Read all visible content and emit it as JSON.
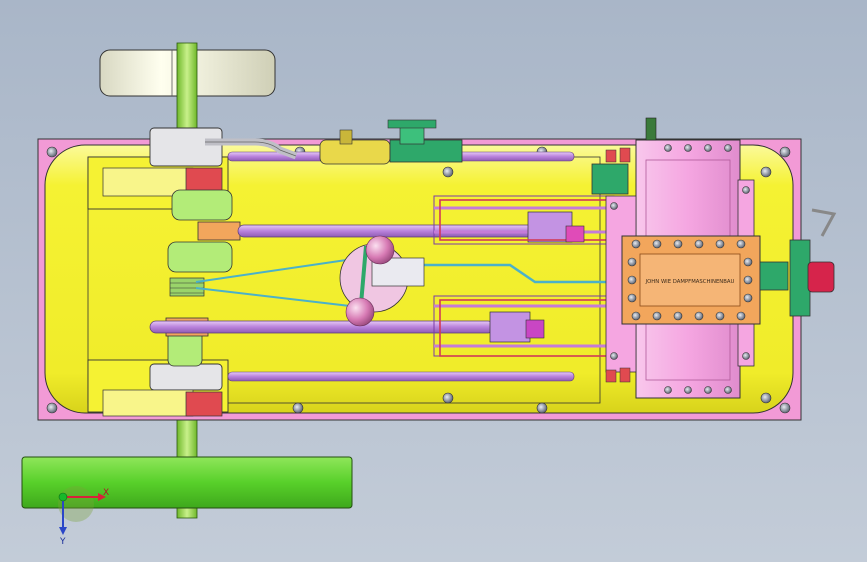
{
  "viewport": {
    "background_top": "#a9b6c8",
    "background_bottom": "#c3ccd8"
  },
  "axis_triad": {
    "x_label": "X",
    "y_label": "Y"
  },
  "nameplate": {
    "text": "JOHN WIE DAMPFMASCHINENBAU"
  },
  "colors": {
    "base_plate": "#f29ad6",
    "boiler": "#f5f233",
    "flywheel_top": "#f1f1df",
    "flywheel_bottom": "#58d02a",
    "shaft": "#98d63c",
    "rod": "#c393e3",
    "cylinder": "#f5a6e1",
    "bolt": "#a3a8b4",
    "red_part": "#e04a50",
    "orange_part": "#f2a65c",
    "green_part": "#2ea86a",
    "cyan_pipe": "#4bb1c9",
    "magenta": "#e04bb8",
    "brass": "#e9d84a",
    "governor_ball": "#d77ab4",
    "crank_red": "#d6244b"
  }
}
